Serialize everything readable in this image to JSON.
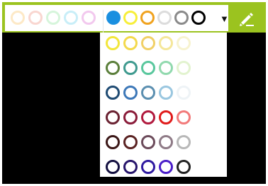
{
  "toolbar": {
    "recent_colors": [
      "#fde9c6",
      "#f9d6d0",
      "#d6f5db",
      "#c8eef8",
      "#f2c8ee"
    ],
    "palette_row": [
      {
        "color": "#1a8fe0",
        "filled": true
      },
      {
        "color": "#f7ef3a",
        "filled": false
      },
      {
        "color": "#f0a21e",
        "filled": false
      },
      {
        "color": "#dcdcdc",
        "filled": false
      },
      {
        "color": "#8a8a8a",
        "filled": false
      },
      {
        "color": "#000000",
        "filled": false
      }
    ],
    "dropdown_icon": "triangle-down-icon",
    "pen_icon": "highlighter-pen-icon"
  },
  "palette_popup": {
    "rows": [
      [
        "#f2e63b",
        "#f3d94c",
        "#f1d067",
        "#f5e79a",
        "#f7f3cf"
      ],
      [
        "#5b7f3b",
        "#3f9a8f",
        "#59c79d",
        "#91d9ae",
        "#e2f3cf"
      ],
      [
        "#1f4b73",
        "#3d78b8",
        "#5b8fb0",
        "#9ac7e0",
        "#eef3f6"
      ],
      [
        "#6a2232",
        "#8a1c3a",
        "#b11a3e",
        "#e01b1b",
        "#f27a7a"
      ],
      [
        "#3b1717",
        "#5a2222",
        "#6c4b5b",
        "#8f7b87",
        "#b8b8b8"
      ],
      [
        "#141040",
        "#27156b",
        "#2f1aa0",
        "#4a1ec9",
        "#222222"
      ]
    ]
  }
}
